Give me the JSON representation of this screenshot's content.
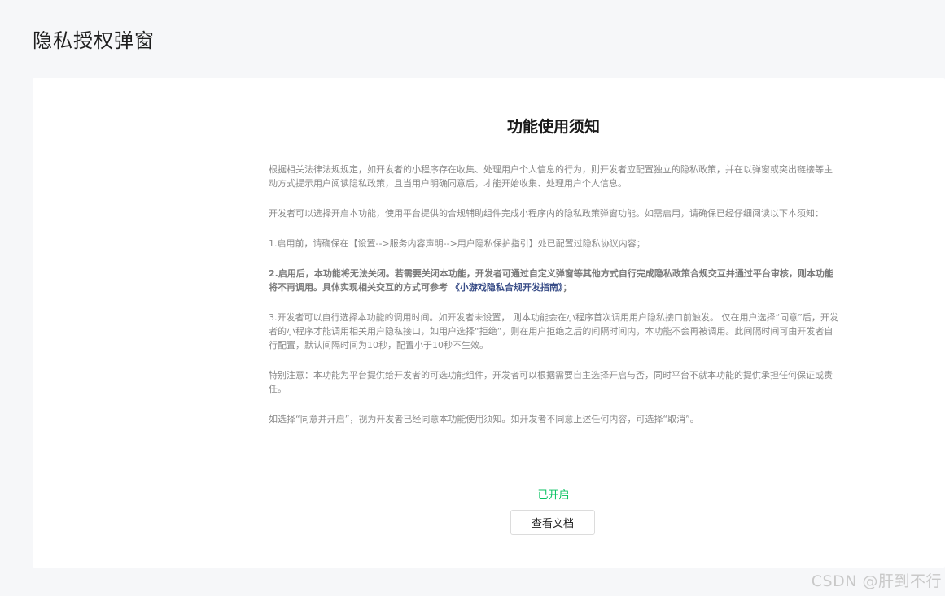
{
  "page": {
    "title": "隐私授权弹窗"
  },
  "notice": {
    "title": "功能使用须知",
    "paragraphs": {
      "p1": "根据相关法律法规规定，如开发者的小程序存在收集、处理用户个人信息的行为，则开发者应配置独立的隐私政策，并在以弹窗或突出链接等主动方式提示用户阅读隐私政策，且当用户明确同意后，才能开始收集、处理用户个人信息。",
      "p2": "开发者可以选择开启本功能，使用平台提供的合规辅助组件完成小程序内的隐私政策弹窗功能。如需启用，请确保已经仔细阅读以下本须知：",
      "p3": "1.启用前，请确保在【设置-->服务内容声明-->用户隐私保护指引】处已配置过隐私协议内容；",
      "p4_text": "2.启用后，本功能将无法关闭。若需要关闭本功能，开发者可通过自定义弹窗等其他方式自行完成隐私政策合规交互并通过平台审核，则本功能将不再调用。具体实现相关交互的方式可参考",
      "p4_link": "《小游戏隐私合规开发指南》",
      "p4_end": "；",
      "p5": "3.开发者可以自行选择本功能的调用时间。如开发者未设置， 则本功能会在小程序首次调用用户隐私接口前触发。 仅在用户选择“同意”后，开发者的小程序才能调用相关用户隐私接口，如用户选择“拒绝”，则在用户拒绝之后的间隔时间内，本功能不会再被调用。此间隔时间可由开发者自行配置，默认间隔时间为10秒，配置小于10秒不生效。",
      "p6": "特别注意：本功能为平台提供给开发者的可选功能组件，开发者可以根据需要自主选择开启与否，同时平台不就本功能的提供承担任何保证或责任。",
      "p7": "如选择“同意并开启”，视为开发者已经同意本功能使用须知。如开发者不同意上述任何内容，可选择“取消”。"
    }
  },
  "status": {
    "label": "已开启",
    "color": "#07c160"
  },
  "actions": {
    "view_docs_label": "查看文档"
  },
  "watermark": {
    "text": "CSDN @肝到不行"
  }
}
